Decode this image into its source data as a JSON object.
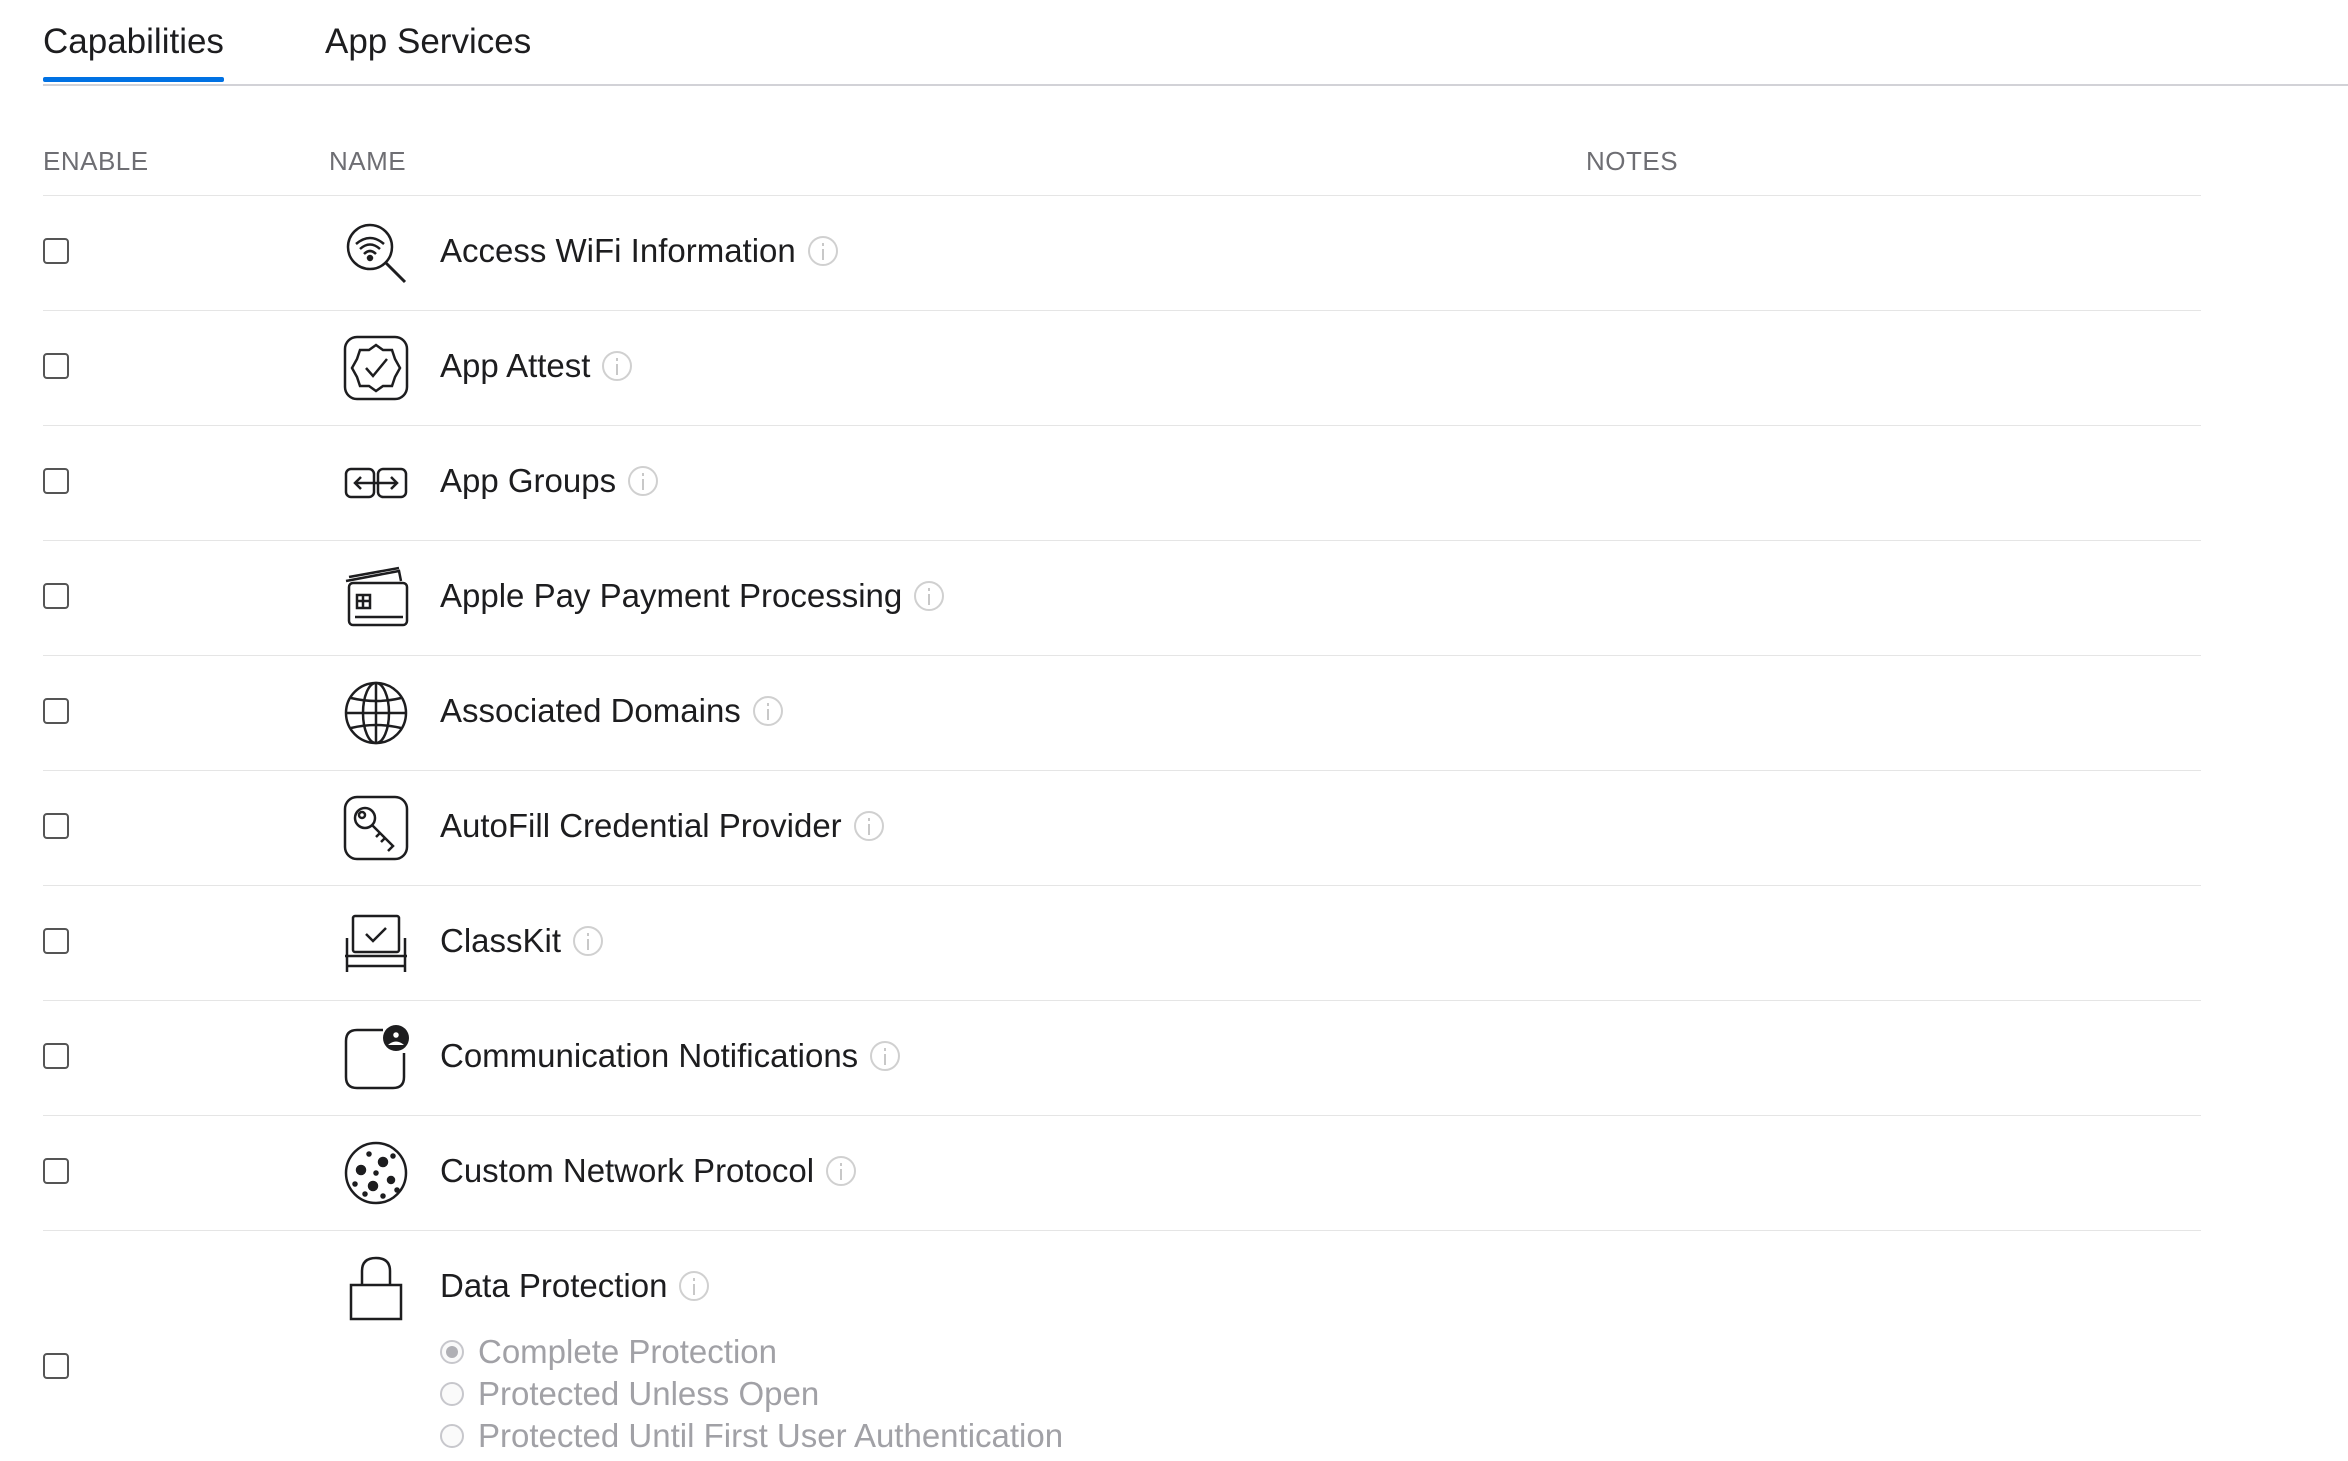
{
  "tabs": [
    {
      "label": "Capabilities",
      "active": true
    },
    {
      "label": "App Services",
      "active": false
    }
  ],
  "table": {
    "headers": {
      "enable": "ENABLE",
      "name": "NAME",
      "notes": "NOTES"
    },
    "rows": [
      {
        "name": "Access WiFi Information",
        "icon": "wifi-search-icon",
        "enabled": false
      },
      {
        "name": "App Attest",
        "icon": "verified-badge-icon",
        "enabled": false
      },
      {
        "name": "App Groups",
        "icon": "app-groups-icon",
        "enabled": false
      },
      {
        "name": "Apple Pay Payment Processing",
        "icon": "credit-cards-icon",
        "enabled": false
      },
      {
        "name": "Associated Domains",
        "icon": "globe-icon",
        "enabled": false
      },
      {
        "name": "AutoFill Credential Provider",
        "icon": "key-icon",
        "enabled": false
      },
      {
        "name": "ClassKit",
        "icon": "classkit-icon",
        "enabled": false
      },
      {
        "name": "Communication Notifications",
        "icon": "communication-notification-icon",
        "enabled": false
      },
      {
        "name": "Custom Network Protocol",
        "icon": "network-protocol-icon",
        "enabled": false
      },
      {
        "name": "Data Protection",
        "icon": "lock-icon",
        "enabled": false,
        "options": [
          {
            "label": "Complete Protection",
            "selected": true
          },
          {
            "label": "Protected Unless Open",
            "selected": false
          },
          {
            "label": "Protected Until First User Authentication",
            "selected": false
          }
        ]
      }
    ]
  }
}
